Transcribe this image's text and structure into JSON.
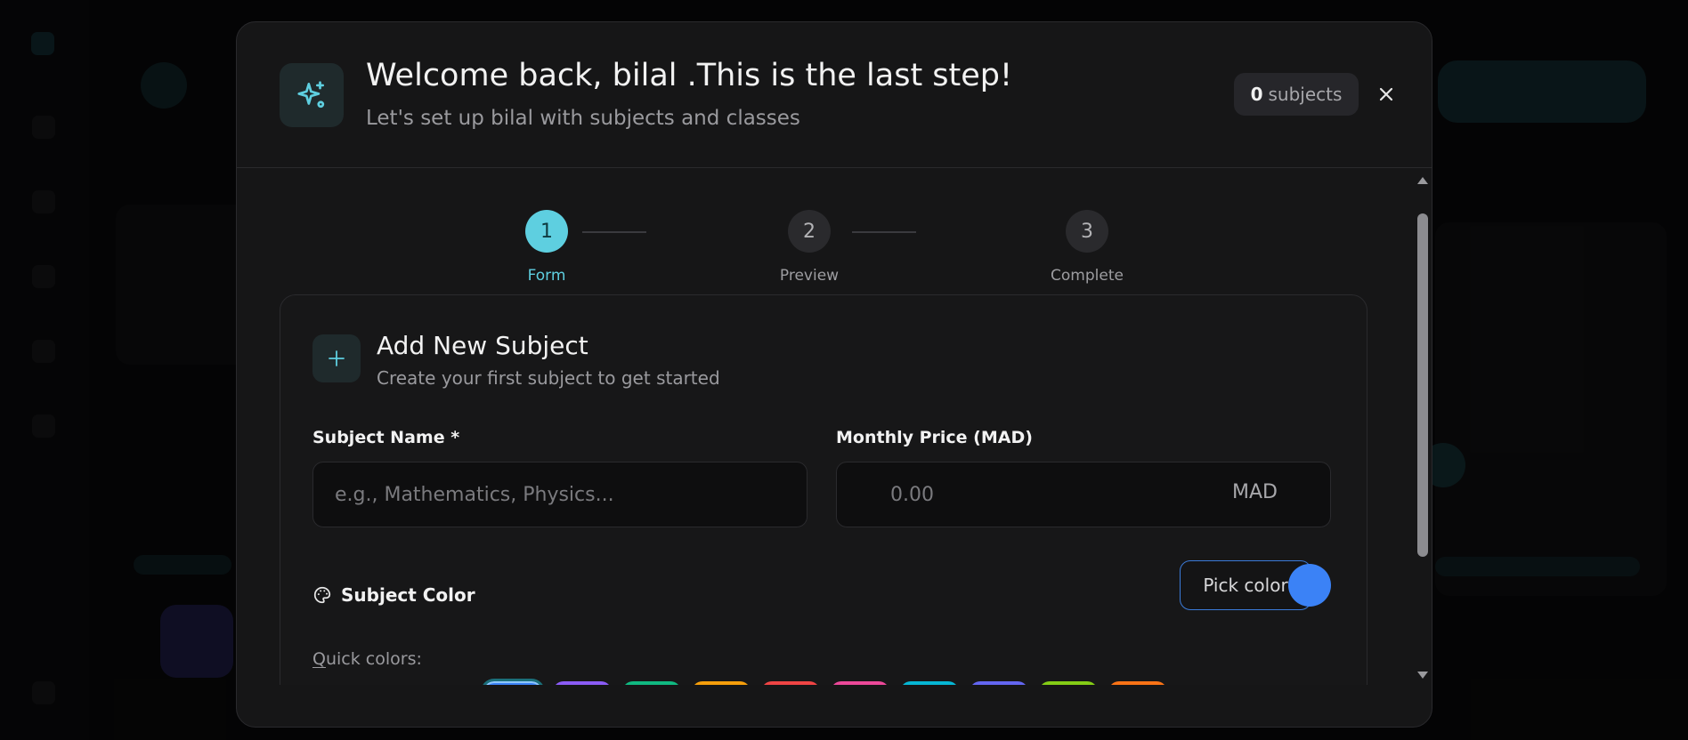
{
  "modal": {
    "title": "Welcome back, bilal .This is the last step!",
    "subtitle": "Let's set up bilal with subjects and classes",
    "subjects_count": "0",
    "subjects_suffix": "subjects",
    "close_label": "×"
  },
  "steps": [
    {
      "number": "1",
      "label": "Form",
      "state": "active"
    },
    {
      "number": "2",
      "label": "Preview",
      "state": "inactive"
    },
    {
      "number": "3",
      "label": "Complete",
      "state": "inactive"
    }
  ],
  "card": {
    "title": "Add New Subject",
    "subtitle": "Create your first subject to get started"
  },
  "form": {
    "subject_name_label": "Subject Name *",
    "subject_name_placeholder": "e.g., Mathematics, Physics...",
    "subject_name_value": "",
    "price_label": "Monthly Price (MAD)",
    "price_placeholder": "0.00",
    "price_value": "",
    "currency": "MAD"
  },
  "color": {
    "label": "Subject Color",
    "pick_button": "Pick color",
    "selected": "#3b82f6",
    "quick_label_first": "Q",
    "quick_label_rest": "uick colors:",
    "quick_colors": [
      "#3b82f6",
      "#8b5cf6",
      "#10b981",
      "#f59e0b",
      "#ef4444",
      "#ec4899",
      "#06b6d4",
      "#6366f1",
      "#84cc16",
      "#f97316"
    ]
  },
  "icons": {
    "header": "sparkles-icon",
    "card": "plus-icon",
    "color": "palette-icon",
    "close": "close-icon"
  }
}
